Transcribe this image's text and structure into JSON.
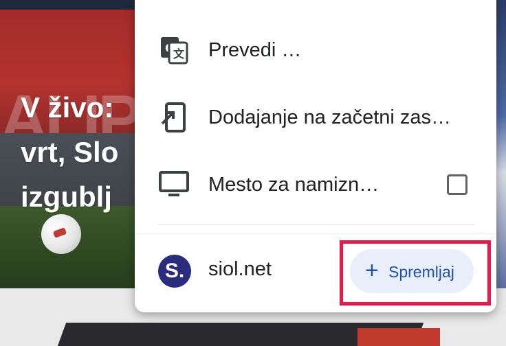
{
  "background": {
    "headline_lines": "V živo:\nvrt, Slo\nizgublj"
  },
  "menu": {
    "items": [
      {
        "icon": "translate-icon",
        "label": "Prevedi …"
      },
      {
        "icon": "add-to-home-screen-icon",
        "label": "Dodajanje na začetni zas…"
      },
      {
        "icon": "desktop-icon",
        "label": "Mesto za namizn…",
        "checkbox_checked": false
      }
    ],
    "site": {
      "logo_text": "S.",
      "name": "siol.net",
      "save_button": {
        "icon": "plus-icon",
        "plus": "+",
        "label": "Spremljaj"
      }
    }
  },
  "colors": {
    "accent": "#1f4fa6",
    "button_bg": "#e8effb",
    "highlight": "#e8194a",
    "logo_bg": "#2c2c7e"
  }
}
